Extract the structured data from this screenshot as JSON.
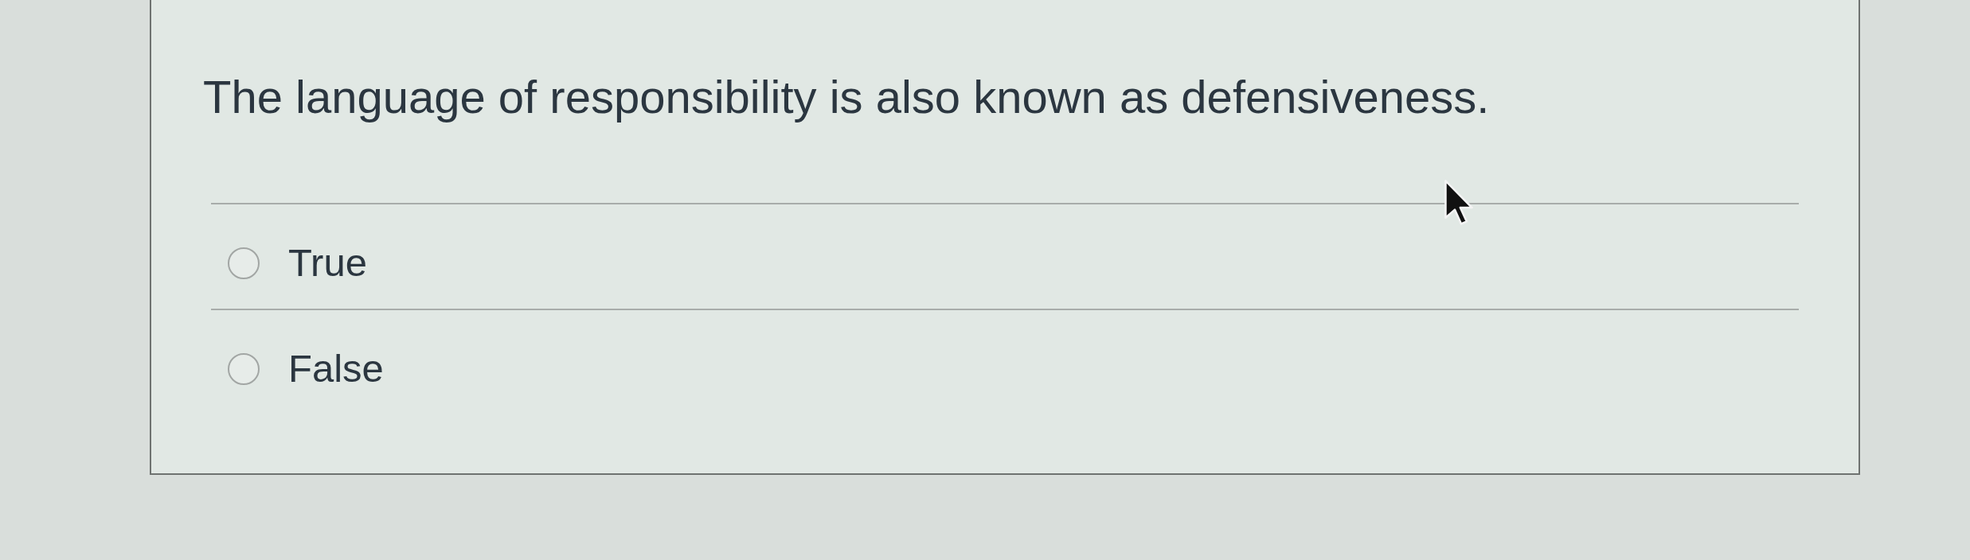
{
  "question": {
    "text": "The language of responsibility is also known as defensiveness."
  },
  "options": [
    {
      "label": "True",
      "selected": false
    },
    {
      "label": "False",
      "selected": false
    }
  ]
}
